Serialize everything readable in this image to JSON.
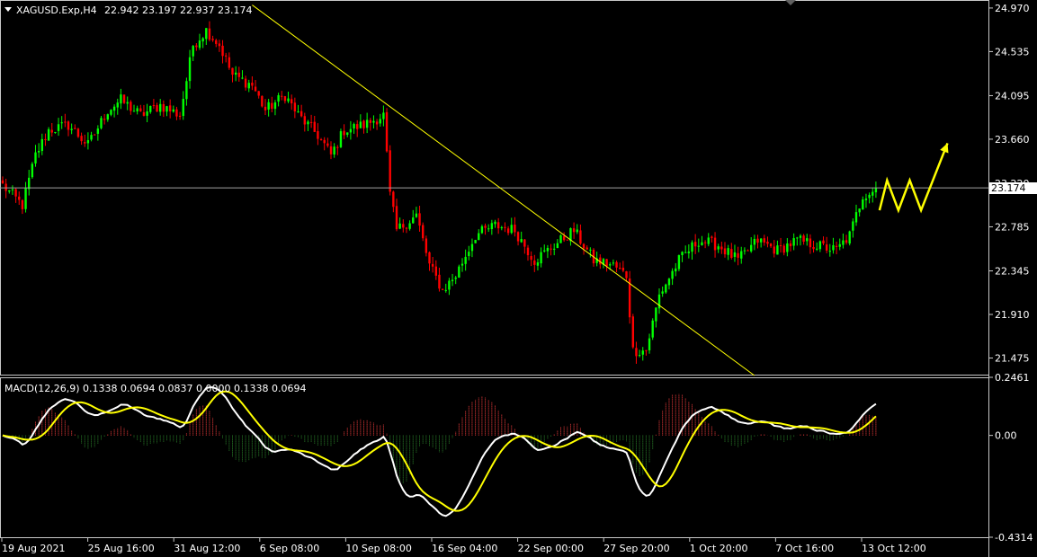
{
  "header": {
    "symbol_info": "XAGUSD.Exp,H4",
    "ohlc": "22.942 23.197 22.937 23.174"
  },
  "macd_header": "MACD(12,26,9) 0.1338 0.0694 0.0837 0.0000 0.1338 0.0694",
  "current_price_label": "23.174",
  "colors": {
    "background": "#000000",
    "bull_candle": "#00ff00",
    "bear_candle": "#ff0000",
    "trendline": "#ffff00",
    "macd_main": "#ffffff",
    "macd_signal": "#ffff00",
    "hist_positive": "#ff4040",
    "hist_negative": "#2e8b2e",
    "projection_arrow": "#ffff00"
  },
  "chart_data": [
    {
      "type": "candlestick",
      "ylim": [
        21.3,
        25.05
      ],
      "y_ticks": [
        "24.970",
        "24.535",
        "24.095",
        "23.660",
        "23.220",
        "22.785",
        "22.345",
        "21.910",
        "21.475"
      ],
      "y_tick_values": [
        24.97,
        24.535,
        24.095,
        23.66,
        23.22,
        22.785,
        22.345,
        21.91,
        21.475
      ],
      "x_tick_labels": [
        "19 Aug 2021",
        "25 Aug 16:00",
        "31 Aug 12:00",
        "6 Sep 08:00",
        "10 Sep 08:00",
        "16 Sep 04:00",
        "22 Sep 00:00",
        "27 Sep 20:00",
        "1 Oct 20:00",
        "7 Oct 16:00",
        "13 Oct 12:00"
      ],
      "current_price": 23.174,
      "close_anchors": [
        [
          0,
          23.2
        ],
        [
          6,
          23.0
        ],
        [
          10,
          23.5
        ],
        [
          14,
          23.75
        ],
        [
          20,
          23.8
        ],
        [
          26,
          23.6
        ],
        [
          32,
          23.95
        ],
        [
          36,
          24.05
        ],
        [
          42,
          23.9
        ],
        [
          48,
          24.0
        ],
        [
          54,
          23.9
        ],
        [
          58,
          24.6
        ],
        [
          62,
          24.75
        ],
        [
          66,
          24.6
        ],
        [
          70,
          24.3
        ],
        [
          76,
          24.2
        ],
        [
          80,
          23.95
        ],
        [
          86,
          24.1
        ],
        [
          90,
          23.9
        ],
        [
          96,
          23.7
        ],
        [
          100,
          23.5
        ],
        [
          104,
          23.75
        ],
        [
          110,
          23.8
        ],
        [
          116,
          23.9
        ],
        [
          118,
          23.1
        ],
        [
          120,
          22.75
        ],
        [
          126,
          22.9
        ],
        [
          130,
          22.4
        ],
        [
          134,
          22.15
        ],
        [
          138,
          22.3
        ],
        [
          144,
          22.7
        ],
        [
          150,
          22.8
        ],
        [
          156,
          22.75
        ],
        [
          162,
          22.45
        ],
        [
          168,
          22.6
        ],
        [
          174,
          22.75
        ],
        [
          180,
          22.45
        ],
        [
          186,
          22.4
        ],
        [
          190,
          22.3
        ],
        [
          192,
          21.55
        ],
        [
          196,
          21.55
        ],
        [
          200,
          22.1
        ],
        [
          206,
          22.45
        ],
        [
          212,
          22.65
        ],
        [
          218,
          22.6
        ],
        [
          224,
          22.45
        ],
        [
          230,
          22.65
        ],
        [
          236,
          22.55
        ],
        [
          242,
          22.65
        ],
        [
          248,
          22.6
        ],
        [
          254,
          22.55
        ],
        [
          258,
          22.7
        ],
        [
          262,
          23.1
        ],
        [
          266,
          23.17
        ]
      ],
      "trendline": {
        "from": [
          76,
          25.0
        ],
        "to": [
          229,
          21.3
        ]
      },
      "projection_arrow": [
        {
          "offset": 0,
          "price": 22.95
        },
        {
          "offset": 2,
          "price": 23.25
        },
        {
          "offset": 5,
          "price": 22.95
        },
        {
          "offset": 8,
          "price": 23.25
        },
        {
          "offset": 11,
          "price": 22.95
        },
        {
          "offset": 18,
          "price": 23.62
        }
      ]
    },
    {
      "type": "macd",
      "ylim": [
        -0.4314,
        0.2461
      ],
      "y_ticks": [
        "0.2461",
        "0.00",
        "-0.4314"
      ],
      "y_tick_values": [
        0.2461,
        0.0,
        -0.4314
      ],
      "parameters": [
        12,
        26,
        9
      ],
      "values": {
        "main": 0.1338,
        "signal": 0.0694
      }
    }
  ]
}
